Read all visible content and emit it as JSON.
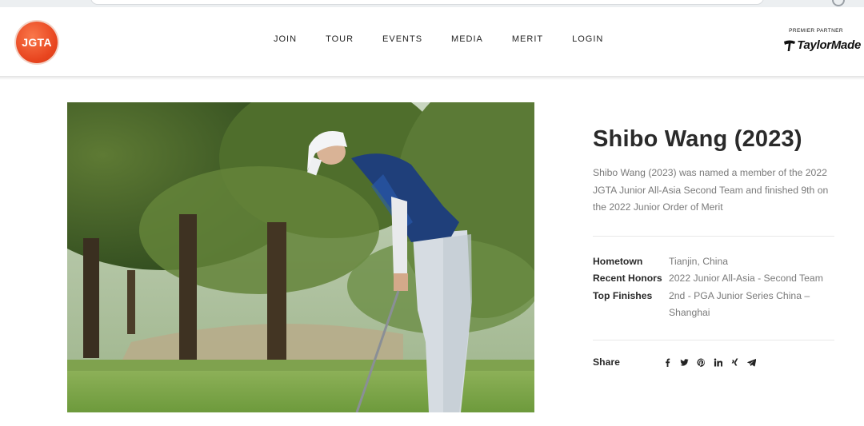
{
  "header": {
    "logo_text": "JGTA",
    "nav": [
      "JOIN",
      "TOUR",
      "EVENTS",
      "MEDIA",
      "MERIT",
      "LOGIN"
    ],
    "sponsor_label": "PREMIER PARTNER",
    "sponsor_name": "TaylorMade"
  },
  "profile": {
    "name": "Shibo Wang (2023)",
    "bio": "Shibo Wang (2023) was named a member of the 2022 JGTA Junior All-Asia Second Team and finished 9th on the 2022 Junior Order of Merit",
    "details": [
      {
        "label": "Hometown",
        "value": "Tianjin, China"
      },
      {
        "label": "Recent Honors",
        "value": "2022 Junior All-Asia - Second Team"
      },
      {
        "label": "Top Finishes",
        "value": "2nd - PGA Junior Series China – Shanghai"
      }
    ]
  },
  "share": {
    "label": "Share",
    "icons": [
      "facebook-icon",
      "twitter-icon",
      "pinterest-icon",
      "linkedin-icon",
      "xing-icon",
      "telegram-icon"
    ]
  },
  "colors": {
    "logo": "#e8451f",
    "text_dark": "#2a2a2a",
    "text_muted": "#7a7a7a"
  }
}
